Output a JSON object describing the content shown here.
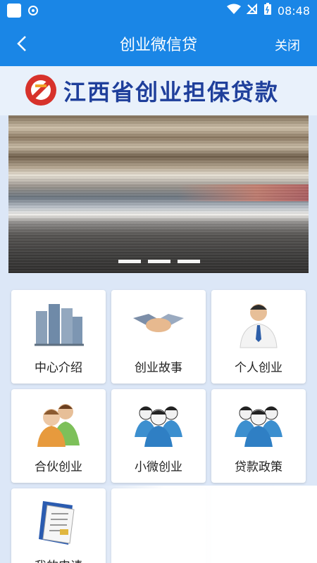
{
  "status": {
    "time": "08:48"
  },
  "header": {
    "title": "创业微信贷",
    "close_label": "关闭"
  },
  "brand": {
    "text": "江西省创业担保贷款"
  },
  "carousel": {
    "dots": 3
  },
  "menu": [
    {
      "label": "中心介绍",
      "icon": "buildings-icon"
    },
    {
      "label": "创业故事",
      "icon": "handshake-icon"
    },
    {
      "label": "个人创业",
      "icon": "businessman-icon"
    },
    {
      "label": "合伙创业",
      "icon": "two-people-icon"
    },
    {
      "label": "小微创业",
      "icon": "group-icon"
    },
    {
      "label": "贷款政策",
      "icon": "group-icon"
    },
    {
      "label": "我的申请",
      "icon": "document-icon"
    },
    {
      "label": "",
      "icon": ""
    },
    {
      "label": "",
      "icon": ""
    }
  ]
}
